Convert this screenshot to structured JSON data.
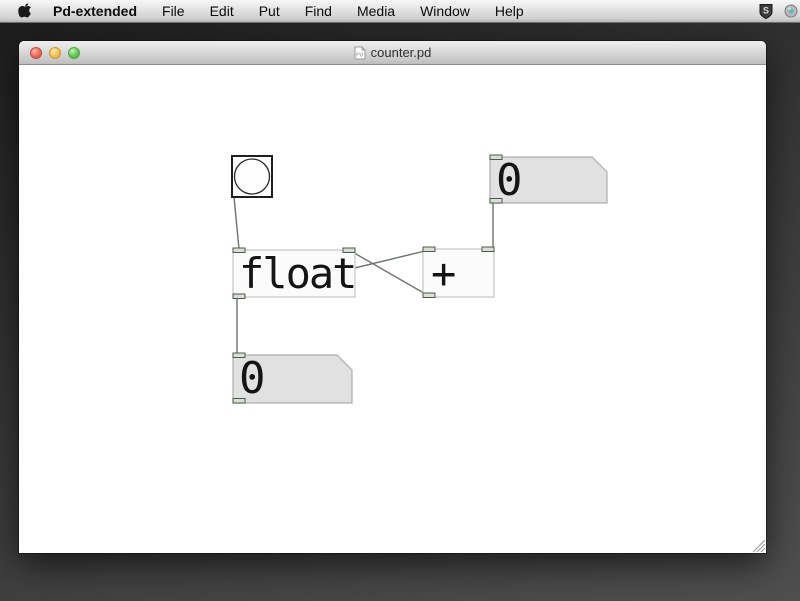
{
  "menu_bar": {
    "app_name": "Pd-extended",
    "items": [
      "File",
      "Edit",
      "Put",
      "Find",
      "Media",
      "Window",
      "Help"
    ],
    "status_icons": [
      "shield-s-icon",
      "screen-sharing-icon"
    ]
  },
  "window": {
    "title": "counter.pd"
  },
  "patch": {
    "objects": [
      {
        "id": "bang",
        "type": "bang"
      },
      {
        "id": "number-top",
        "type": "number-box",
        "value": "0"
      },
      {
        "id": "float",
        "type": "object-box",
        "label": "float"
      },
      {
        "id": "plus",
        "type": "object-box",
        "label": "+"
      },
      {
        "id": "number-bottom",
        "type": "number-box",
        "value": "0"
      }
    ],
    "connections": [
      {
        "from": "bang outlet",
        "to": "float left inlet"
      },
      {
        "from": "float outlet",
        "to": "plus left inlet"
      },
      {
        "from": "plus outlet",
        "to": "float right inlet"
      },
      {
        "from": "number-top outlet",
        "to": "plus right inlet"
      },
      {
        "from": "float outlet",
        "to": "number-bottom inlet"
      }
    ]
  },
  "colors": {
    "wire": "#6b756b",
    "object_border": "#c6c6c6",
    "object_fill": "#fbfbfb",
    "number_fill": "#e1e1e1",
    "number_border": "#adadad",
    "nub_fill": "#d9ded6",
    "nub_border": "#4f584f",
    "desktop": "#353535",
    "traffic_red": "#ec6a5e",
    "traffic_yellow": "#f5bf4f",
    "traffic_green": "#61c554"
  }
}
